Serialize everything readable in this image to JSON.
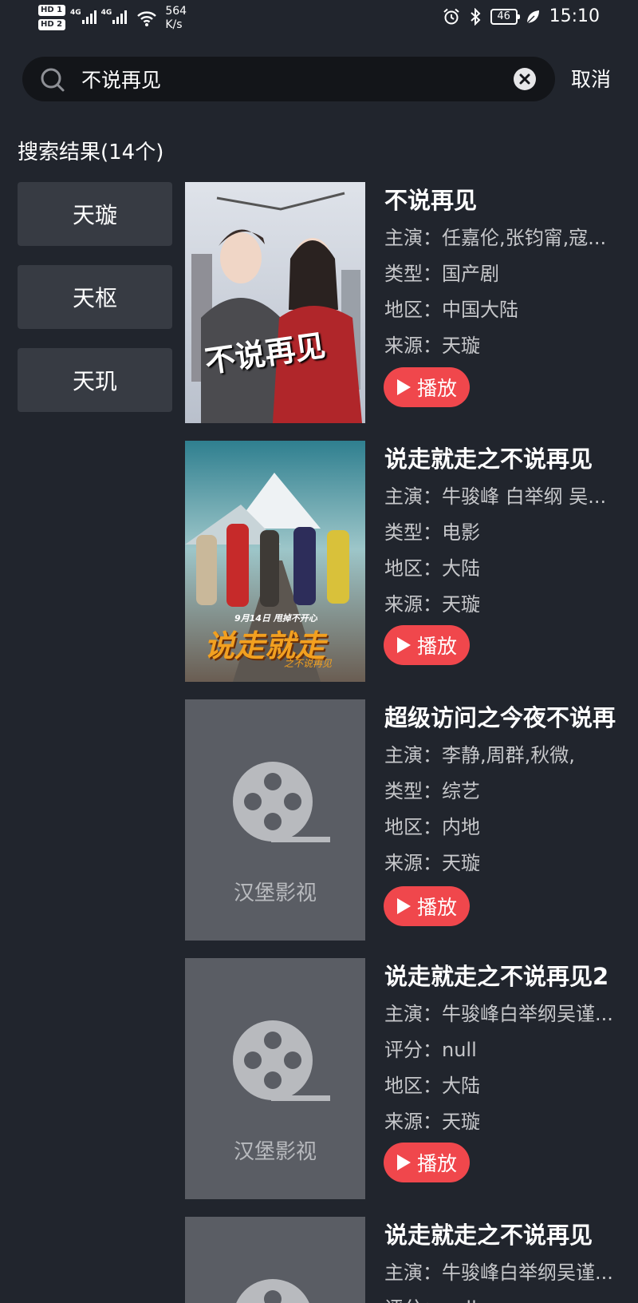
{
  "status_bar": {
    "hd1": "HD 1",
    "hd2": "HD 2",
    "net1": "4G",
    "net2": "4G",
    "speed_value": "564",
    "speed_unit": "K/s",
    "battery": "46",
    "time": "15:10"
  },
  "search": {
    "query": "不说再见",
    "cancel_label": "取消"
  },
  "results_title": "搜索结果(14个)",
  "sources": [
    {
      "label": "天璇"
    },
    {
      "label": "天枢"
    },
    {
      "label": "天玑"
    }
  ],
  "play_label": "播放",
  "placeholder_text": "汉堡影视",
  "results": [
    {
      "title": "不说再见",
      "lines": [
        "主演：任嘉伦,张钧甯,寇...",
        "类型：国产剧",
        "地区：中国大陆",
        "来源：天璇"
      ],
      "poster_caption": "不说再见"
    },
    {
      "title": "说走就走之不说再见",
      "lines": [
        "主演：牛骏峰 白举纲 吴...",
        "类型：电影",
        "地区：大陆",
        "来源：天璇"
      ],
      "poster_tagline": "9月14日 甩掉不开心",
      "poster_caption": "说走就走",
      "poster_subcaption": "之不说再见"
    },
    {
      "title": "超级访问之今夜不说再",
      "lines": [
        "主演：李静,周群,秋微,",
        "类型：综艺",
        "地区：内地",
        "来源：天璇"
      ]
    },
    {
      "title": "说走就走之不说再见2",
      "lines": [
        "主演：牛骏峰白举纲吴谨...",
        "评分：null",
        "地区：大陆",
        "来源：天璇"
      ]
    },
    {
      "title": "说走就走之不说再见",
      "lines": [
        "主演：牛骏峰白举纲吴谨...",
        "评分：null"
      ]
    }
  ],
  "colors": {
    "background": "#21252d",
    "search_bg": "#131519",
    "tab_bg": "#373b43",
    "accent": "#f0474c",
    "placeholder_bg": "#5a5d64"
  }
}
